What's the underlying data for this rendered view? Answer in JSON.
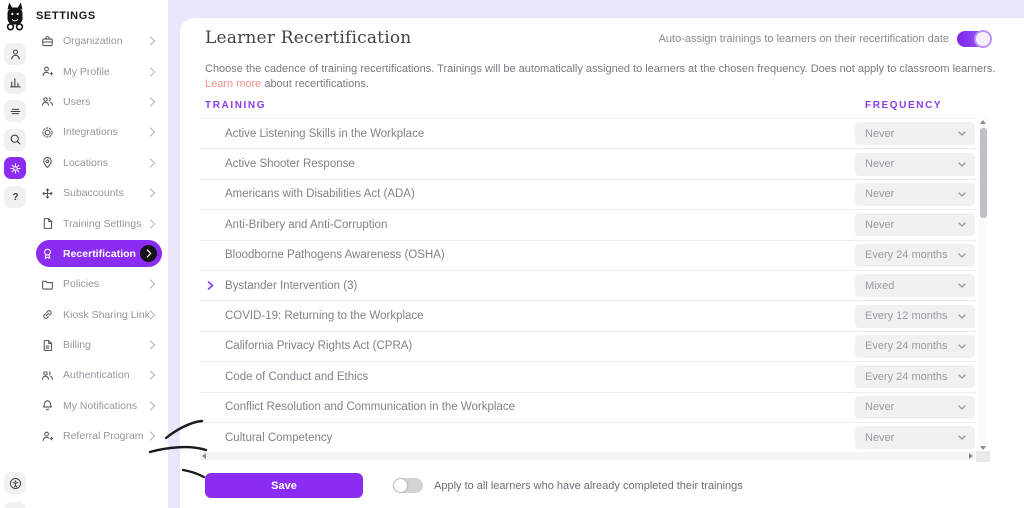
{
  "rail": {
    "logo": "easyllama llama logo",
    "icons": [
      {
        "name": "user"
      },
      {
        "name": "reports"
      },
      {
        "name": "content"
      },
      {
        "name": "search"
      },
      {
        "name": "gear",
        "active": true
      },
      {
        "name": "help"
      }
    ],
    "bottom_icon": "accessibility"
  },
  "sidebar": {
    "title": "SETTINGS",
    "items": [
      {
        "label": "Organization",
        "icon": "briefcase"
      },
      {
        "label": "My Profile",
        "icon": "user-plus"
      },
      {
        "label": "Users",
        "icon": "users"
      },
      {
        "label": "Integrations",
        "icon": "integrations"
      },
      {
        "label": "Locations",
        "icon": "location"
      },
      {
        "label": "Subaccounts",
        "icon": "subaccounts"
      },
      {
        "label": "Training Settings",
        "icon": "file"
      },
      {
        "label": "Recertification",
        "icon": "badge",
        "active": true
      },
      {
        "label": "Policies",
        "icon": "folder"
      },
      {
        "label": "Kiosk Sharing Link",
        "icon": "link"
      },
      {
        "label": "Billing",
        "icon": "billing"
      },
      {
        "label": "Authentication",
        "icon": "users"
      },
      {
        "label": "My Notifications",
        "icon": "bell"
      },
      {
        "label": "Referral Program",
        "icon": "user-plus"
      }
    ]
  },
  "main": {
    "title": "Learner Recertification",
    "auto_assign_toggle": {
      "label": "Auto-assign trainings to learners on their recertification date",
      "on": true
    },
    "description": {
      "text_before": "Choose the cadence of training recertifications. Trainings will be automatically assigned to learners at the chosen frequency. Does not apply to classroom learners. ",
      "link": "Learn more",
      "text_after": " about recertifications."
    },
    "columns": {
      "training": "TRAINING",
      "frequency": "FREQUENCY"
    },
    "rows": [
      {
        "name": "Active Listening Skills in the Workplace",
        "frequency": "Never"
      },
      {
        "name": "Active Shooter Response",
        "frequency": "Never"
      },
      {
        "name": "Americans with Disabilities Act (ADA)",
        "frequency": "Never"
      },
      {
        "name": "Anti-Bribery and Anti-Corruption",
        "frequency": "Never"
      },
      {
        "name": "Bloodborne Pathogens Awareness (OSHA)",
        "frequency": "Every 24 months"
      },
      {
        "name": "Bystander Intervention (3)",
        "frequency": "Mixed",
        "expandable": true
      },
      {
        "name": "COVID-19: Returning to the Workplace",
        "frequency": "Every 12 months"
      },
      {
        "name": "California Privacy Rights Act (CPRA)",
        "frequency": "Every 24 months"
      },
      {
        "name": "Code of Conduct and Ethics",
        "frequency": "Every 24 months"
      },
      {
        "name": "Conflict Resolution and Communication in the Workplace",
        "frequency": "Never"
      },
      {
        "name": "Cultural Competency",
        "frequency": "Never"
      }
    ],
    "footer": {
      "save_label": "Save",
      "apply_toggle": {
        "label": "Apply to all learners who have already completed their trainings",
        "on": false
      }
    }
  },
  "colors": {
    "accent": "#8a2cf1",
    "column_header": "#8b3bf2",
    "link": "#f2918b",
    "page_background": "#ece4fa"
  }
}
